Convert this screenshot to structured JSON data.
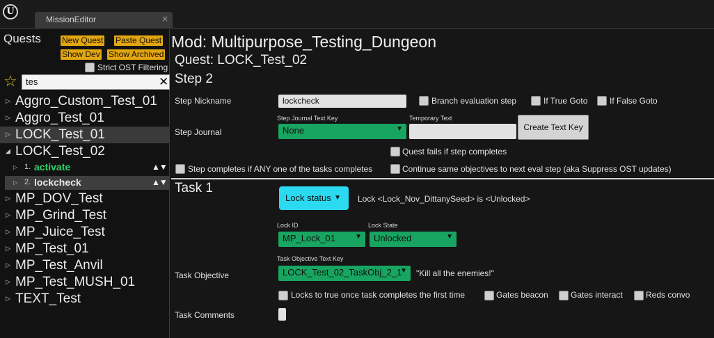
{
  "window": {
    "tab_title": "MissionEditor",
    "tab_close": "×",
    "logo": "U"
  },
  "sidebar": {
    "title": "Quests",
    "buttons": {
      "new_quest": "New Quest",
      "paste_quest": "Paste Quest",
      "show_dev": "Show Dev",
      "show_archived": "Show Archived"
    },
    "strict_filter_label": "Strict OST Filtering",
    "search_value": "tes",
    "search_clear": "✕",
    "star_icon": "☆",
    "quests": [
      {
        "name": "Aggro_Custom_Test_01",
        "arrow": "▷"
      },
      {
        "name": "Aggro_Test_01",
        "arrow": "▷"
      },
      {
        "name": "LOCK_Test_01",
        "arrow": "▷"
      },
      {
        "name": "LOCK_Test_02",
        "arrow": "◢"
      },
      {
        "name": "MP_DOV_Test",
        "arrow": "▷"
      },
      {
        "name": "MP_Grind_Test",
        "arrow": "▷"
      },
      {
        "name": "MP_Juice_Test",
        "arrow": "▷"
      },
      {
        "name": "MP_Test_01",
        "arrow": "▷"
      },
      {
        "name": "MP_Test_Anvil",
        "arrow": "▷"
      },
      {
        "name": "MP_Test_MUSH_01",
        "arrow": "▷"
      },
      {
        "name": "TEXT_Test",
        "arrow": "▷"
      }
    ],
    "steps": [
      {
        "num": "1.",
        "name": "activate",
        "color": "#2dd66a",
        "arrow": "▷",
        "move": "▲▼"
      },
      {
        "num": "2.",
        "name": "lockcheck",
        "color": "#e8e8e8",
        "arrow": "▷",
        "move": "▲▼"
      }
    ]
  },
  "main": {
    "mod_title": "Mod: Multipurpose_Testing_Dungeon",
    "quest_title": "Quest: LOCK_Test_02",
    "step_header": "Step 2",
    "step_nickname_label": "Step Nickname",
    "step_nickname_value": "lockcheck",
    "branch_eval_label": "Branch evaluation step",
    "if_true_label": "If True Goto",
    "if_false_label": "If False Goto",
    "step_journal_label": "Step Journal",
    "journal_key_label": "Step Journal Text Key",
    "journal_key_value": "None",
    "temp_text_label": "Temporary Text",
    "temp_text_value": "",
    "create_text_key": "Create Text Key",
    "quest_fails_label": "Quest fails if step completes",
    "step_any_label": "Step completes if ANY one of the tasks completes",
    "continue_label": "Continue same objectives to next eval step (aka Suppress OST updates)",
    "task_header": "Task 1",
    "task_type": "Lock status",
    "lock_text": "Lock <Lock_Nov_DittanySeed> is <Unlocked>",
    "lock_id_label": "Lock ID",
    "lock_id_value": "MP_Lock_01",
    "lock_state_label": "Lock State",
    "lock_state_value": "Unlocked",
    "task_obj_key_label": "Task Objective Text Key",
    "task_objective_label": "Task Objective",
    "task_obj_key_value": "LOCK_Test_02_TaskObj_2_1",
    "task_obj_text": "\"Kill all the enemies!\"",
    "locks_true_label": "Locks to true once task completes the first time",
    "gates_beacon_label": "Gates beacon",
    "gates_interact_label": "Gates interact",
    "reds_convo_label": "Reds convo",
    "task_comments_label": "Task Comments",
    "caret": "▼"
  },
  "colors": {
    "accent_yellow": "#e2a610",
    "select_green": "#18a561",
    "cyan_button": "#2bd9f0",
    "step_active_green": "#2dd66a"
  }
}
